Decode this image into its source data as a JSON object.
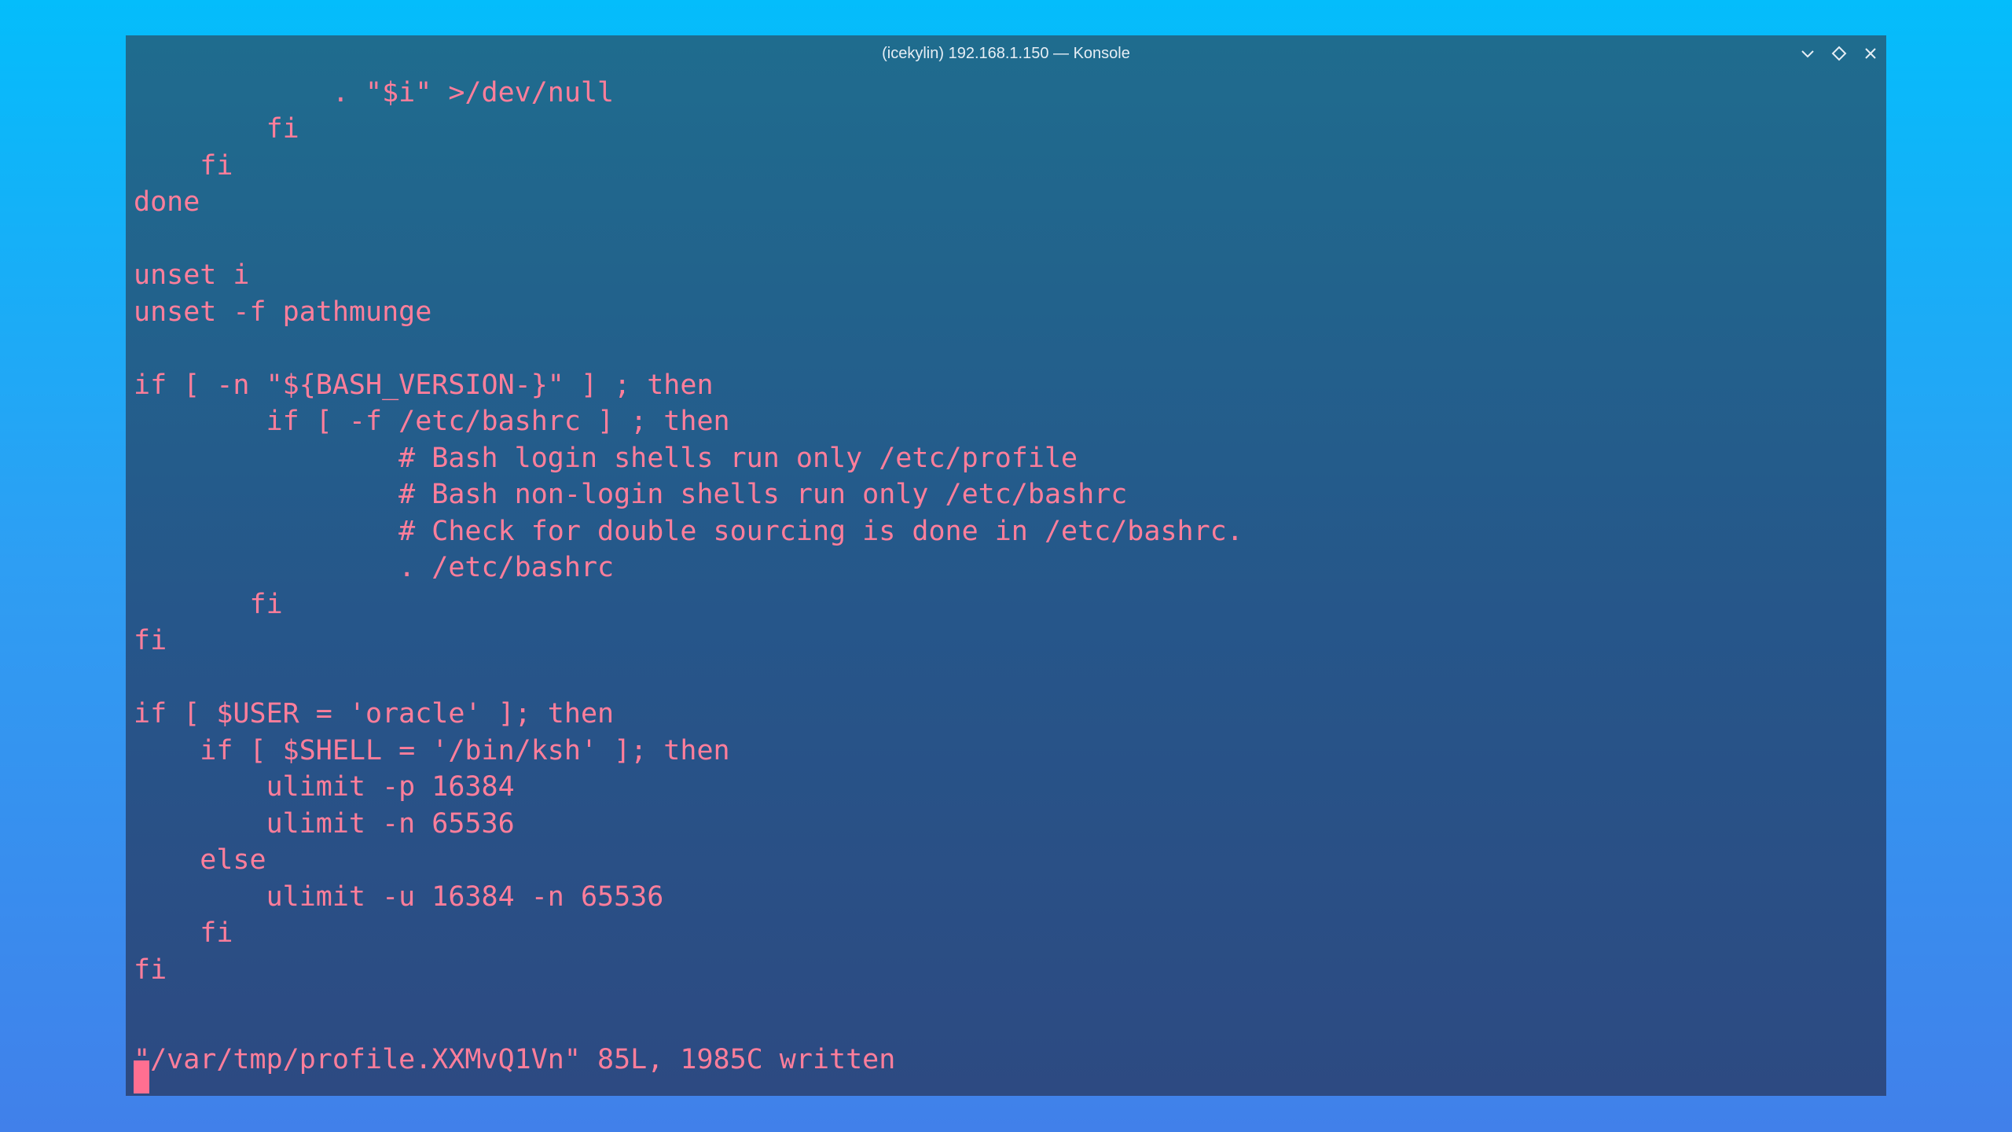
{
  "window": {
    "title": "(icekylin) 192.168.1.150 — Konsole",
    "controls": [
      "chevron-down-icon",
      "diamond-icon",
      "close-icon"
    ]
  },
  "terminal": {
    "text_color": "#ff7e9b",
    "lines": [
      "            . \"$i\" >/dev/null",
      "        fi",
      "    fi",
      "done",
      "",
      "unset i",
      "unset -f pathmunge",
      "",
      "if [ -n \"${BASH_VERSION-}\" ] ; then",
      "        if [ -f /etc/bashrc ] ; then",
      "                # Bash login shells run only /etc/profile",
      "                # Bash non-login shells run only /etc/bashrc",
      "                # Check for double sourcing is done in /etc/bashrc.",
      "                . /etc/bashrc",
      "       fi",
      "fi",
      "",
      "if [ $USER = 'oracle' ]; then",
      "    if [ $SHELL = '/bin/ksh' ]; then",
      "        ulimit -p 16384",
      "        ulimit -n 65536",
      "    else",
      "        ulimit -u 16384 -n 65536",
      "    fi",
      "fi"
    ],
    "status_line": "\"/var/tmp/profile.XXMvQ1Vn\" 85L, 1985C written"
  }
}
